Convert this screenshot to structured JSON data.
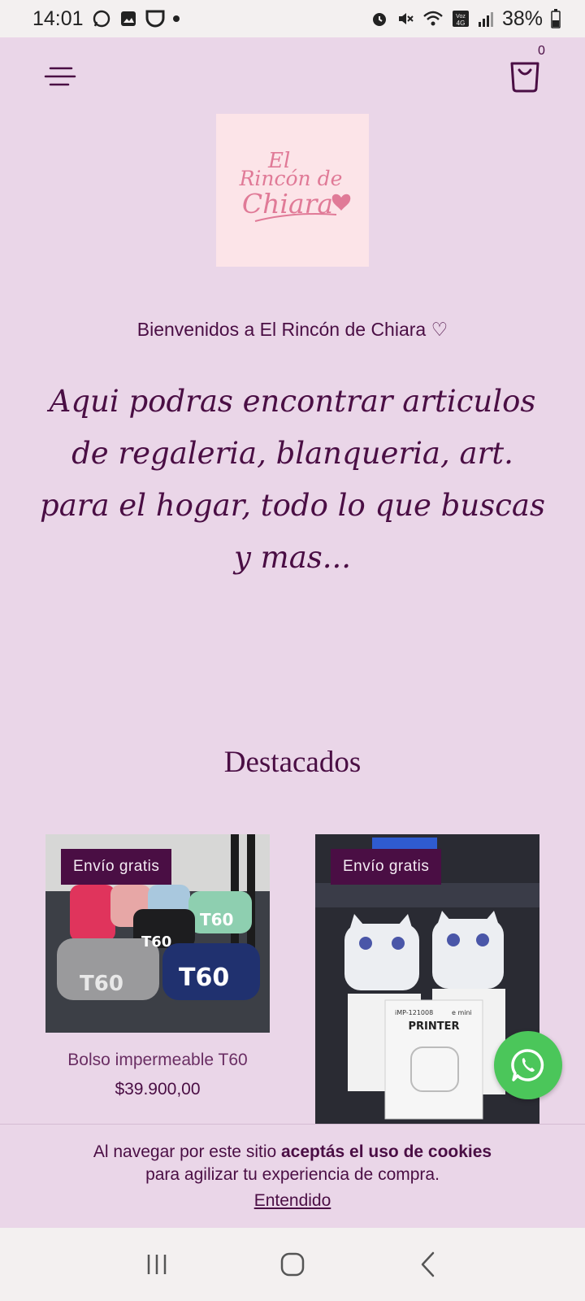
{
  "status_bar": {
    "time": "14:01",
    "battery": "38%",
    "network_label": "Voz 4G"
  },
  "header": {
    "cart_count": "0"
  },
  "logo": {
    "line1": "El",
    "line2": "Rincón de",
    "line3": "Chiara",
    "color": "#e07a97"
  },
  "hero": {
    "welcome": "Bienvenidos a El Rincón de Chiara ♡",
    "tagline": "Aqui podras encontrar articulos de regaleria, blanqueria, art. para el hogar, todo lo que buscas y mas..."
  },
  "featured": {
    "title": "Destacados",
    "products": [
      {
        "badge": "Envío gratis",
        "name": "Bolso impermeable T60",
        "price": "$39.900,00",
        "image_text": [
          "T60",
          "T60",
          "T60",
          "T60"
        ]
      },
      {
        "badge": "Envío gratis",
        "name": "",
        "price": "",
        "image_text": [
          "PRINTER",
          "iMP-121008",
          "e mini"
        ]
      }
    ]
  },
  "cookie_banner": {
    "text_before": "Al navegar por este sitio ",
    "text_bold": "aceptás el uso de cookies",
    "text_line2": "para agilizar tu experiencia de compra.",
    "accept_label": "Entendido"
  },
  "colors": {
    "background": "#ead6e8",
    "primary": "#4a0e44",
    "whatsapp": "#4bc65a"
  }
}
